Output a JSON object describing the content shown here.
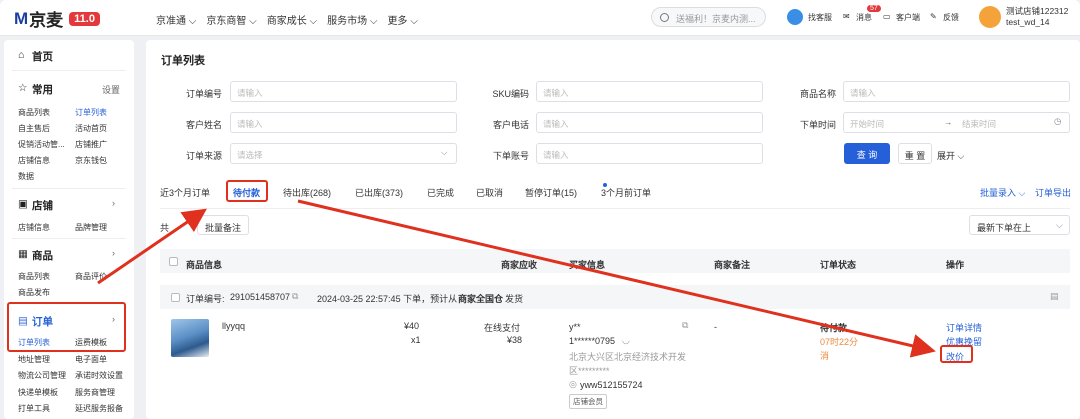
{
  "top": {
    "logo_m": "M",
    "logo_text": "京麦",
    "logo_badge": "11.0",
    "nav": [
      "京准通",
      "京东商智",
      "商家成长",
      "服务市场",
      "更多"
    ],
    "search_placeholder": "送福利！京麦内测...",
    "kefu": "找客服",
    "msg": "消息",
    "msg_count": "57",
    "client": "客户端",
    "feedback": "反馈",
    "store_name": "测试店铺122312",
    "user_id": "test_wd_14"
  },
  "sidebar": {
    "home": "首页",
    "common": "常用",
    "settings": "设置",
    "common_items": [
      "商品列表",
      "订单列表",
      "自主售后",
      "活动首页",
      "促销活动管...",
      "店铺推广",
      "店铺信息",
      "京东钱包",
      "数据"
    ],
    "shop": "店铺",
    "shop_items": [
      "店铺信息",
      "品牌管理"
    ],
    "product": "商品",
    "product_items": [
      "商品列表",
      "商品评价",
      "商品发布"
    ],
    "order": "订单",
    "order_items": [
      "订单列表",
      "运费模板",
      "地址管理",
      "电子面单",
      "物流公司管理",
      "承诺时效设置",
      "快递单模板",
      "服务商管理",
      "打单工具",
      "延迟服务报备"
    ]
  },
  "main": {
    "title": "订单列表",
    "filters": {
      "order_no": "订单编号",
      "sku": "SKU编码",
      "product_name": "商品名称",
      "customer_name": "客户姓名",
      "customer_phone": "客户电话",
      "order_time": "下单时间",
      "order_source": "订单来源",
      "order_account": "下单账号",
      "ph_input": "请输入",
      "ph_select": "请选择",
      "start_time": "开始时间",
      "arrow": "→",
      "end_time": "结束时间"
    },
    "query": "查 询",
    "reset": "重 置",
    "expand": "展开",
    "tabs": [
      "近3个月订单",
      "待付款",
      "待出库(268)",
      "已出库(373)",
      "已完成",
      "已取消",
      "暂停订单(15)",
      "3个月前订单"
    ],
    "batch_entry": "批量录入",
    "export": "订单导出",
    "total_prefix": "共",
    "batch_note": "批量备注",
    "sort": "最新下单在上",
    "headers": [
      "商品信息",
      "商家应收",
      "买家信息",
      "商家备注",
      "订单状态",
      "操作"
    ],
    "order": {
      "no_label": "订单编号:",
      "no": "291051458707",
      "time_info": "2024-03-25 22:57:45 下单，预计从",
      "warehouse": "商家全国仓",
      "ship": "发货",
      "product_title": "llyyqq",
      "price": "¥40",
      "qty": "x1",
      "pay_type": "在线支付",
      "receivable": "¥38",
      "buyer_name": "y**",
      "buyer_phone": "1******0795",
      "buyer_addr1": "北京大兴区北京经济技术开发",
      "buyer_addr2": "区*********",
      "buyer_jd": "yww512155724",
      "buyer_tag": "店铺会员",
      "note": "-",
      "status": "待付款",
      "status_detail1": "07时22分",
      "status_detail2": "消",
      "op1": "订单详情",
      "op2": "优惠挽留",
      "op3": "改价"
    }
  },
  "colors": {
    "accent": "#2660d8",
    "brand_red": "#e4393c",
    "annotation": "#e0301e"
  }
}
